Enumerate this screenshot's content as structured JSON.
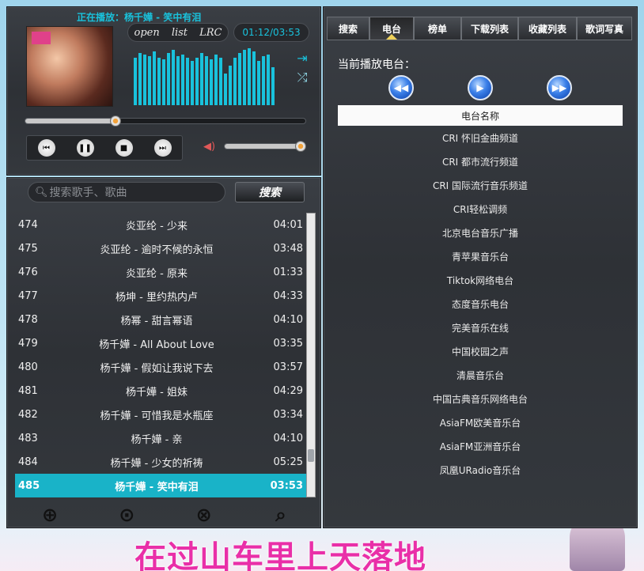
{
  "player": {
    "now_playing": "正在播放：杨千嬅 - 笑中有泪",
    "mode_buttons": [
      "open",
      "list",
      "LRC"
    ],
    "time": "01:12/03:53",
    "progress_fraction": 0.32,
    "volume_fraction": 0.95
  },
  "playlist": {
    "search_placeholder": "搜索歌手、歌曲",
    "search_button": "搜索",
    "rows": [
      {
        "num": "474",
        "title": "炎亚纶 - 少来",
        "dur": "04:01"
      },
      {
        "num": "475",
        "title": "炎亚纶 - 逾时不候的永恒",
        "dur": "03:48"
      },
      {
        "num": "476",
        "title": "炎亚纶 - 原来",
        "dur": "01:33"
      },
      {
        "num": "477",
        "title": "杨坤 - 里约热内卢",
        "dur": "04:33"
      },
      {
        "num": "478",
        "title": "杨幂 - 甜言幂语",
        "dur": "04:10"
      },
      {
        "num": "479",
        "title": "杨千嬅 - All About Love",
        "dur": "03:35"
      },
      {
        "num": "480",
        "title": "杨千嬅 - 假如让我说下去",
        "dur": "03:57"
      },
      {
        "num": "481",
        "title": "杨千嬅 - 姐妹",
        "dur": "04:29"
      },
      {
        "num": "482",
        "title": "杨千嬅 - 可惜我是水瓶座",
        "dur": "03:34"
      },
      {
        "num": "483",
        "title": "杨千嬅 - 亲",
        "dur": "04:10"
      },
      {
        "num": "484",
        "title": "杨千嬅 - 少女的祈祷",
        "dur": "05:25"
      },
      {
        "num": "485",
        "title": "杨千嬅 - 笑中有泪",
        "dur": "03:53"
      }
    ]
  },
  "tabs": [
    "搜索",
    "电台",
    "榜单",
    "下载列表",
    "收藏列表",
    "歌词写真"
  ],
  "radio": {
    "current_label": "当前播放电台：",
    "header": "电台名称",
    "stations": [
      "CRI 怀旧金曲频道",
      "CRI 都市流行频道",
      "CRI 国际流行音乐频道",
      "CRI轻松调频",
      "北京电台音乐广播",
      "青苹果音乐台",
      "Tiktok网络电台",
      "态度音乐电台",
      "完美音乐在线",
      "中国校园之声",
      "清晨音乐台",
      "中国古典音乐网络电台",
      "AsiaFM欧美音乐台",
      "AsiaFM亚洲音乐台",
      "凤凰URadio音乐台"
    ]
  },
  "lyric": "在过山车里上天落地",
  "colors": {
    "accent": "#19c2dc",
    "active_row": "#19b3c8",
    "lyric": "#e92fa8"
  }
}
